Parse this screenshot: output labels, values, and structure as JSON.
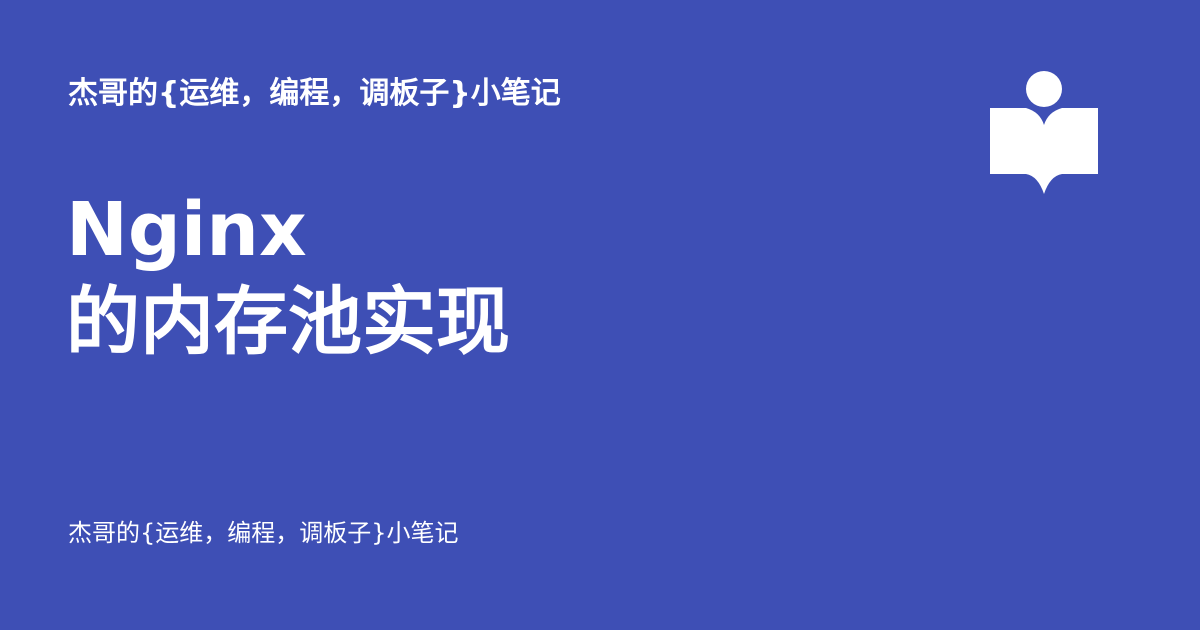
{
  "header": {
    "site_name": "杰哥的{运维，编程，调板子}小笔记"
  },
  "title": {
    "line1": "Nginx",
    "line2": "的内存池实现"
  },
  "footer": {
    "site_name": "杰哥的{运维，编程，调板子}小笔记"
  },
  "logo": {
    "icon": "book-reader-icon"
  },
  "colors": {
    "background": "#3e4fb5",
    "foreground": "#ffffff"
  }
}
